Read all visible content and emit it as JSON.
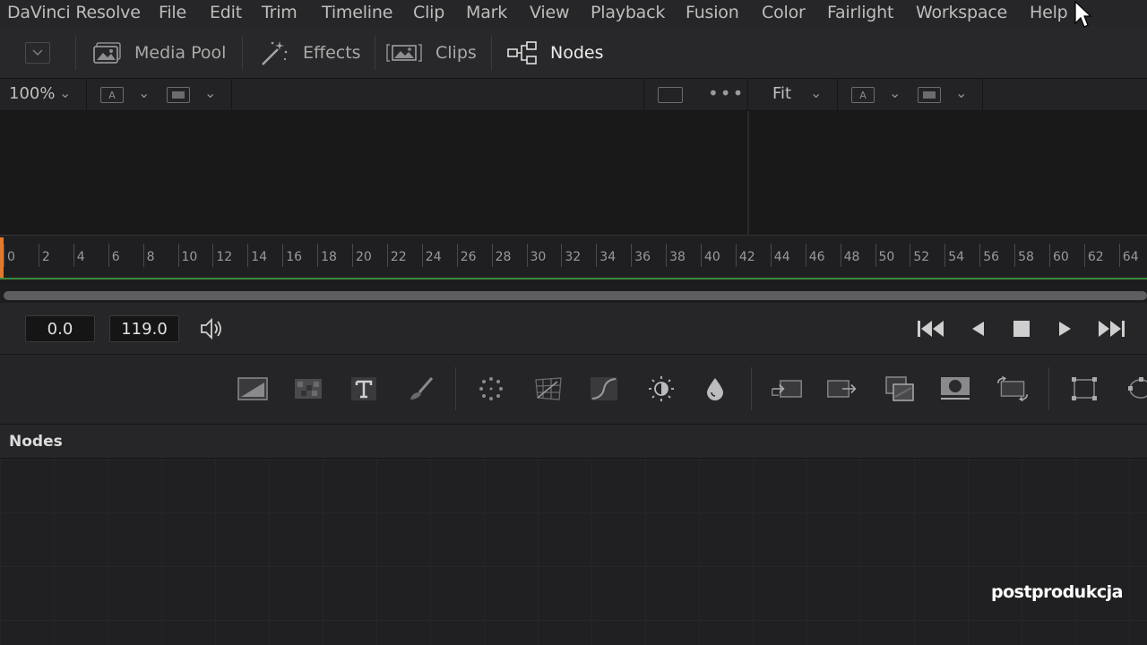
{
  "menu": [
    "DaVinci Resolve",
    "File",
    "Edit",
    "Trim",
    "Timeline",
    "Clip",
    "Mark",
    "View",
    "Playback",
    "Fusion",
    "Color",
    "Fairlight",
    "Workspace",
    "Help"
  ],
  "toolbar": {
    "media_pool": "Media Pool",
    "effects": "Effects",
    "clips": "Clips",
    "nodes": "Nodes"
  },
  "viewer": {
    "zoom": "100%",
    "fit": "Fit",
    "channel_label": "A"
  },
  "ruler_labels": [
    "0",
    "2",
    "4",
    "6",
    "8",
    "10",
    "12",
    "14",
    "16",
    "18",
    "20",
    "22",
    "24",
    "26",
    "28",
    "30",
    "32",
    "34",
    "36",
    "38",
    "40",
    "42",
    "44",
    "46",
    "48",
    "50",
    "52",
    "54",
    "56",
    "58",
    "60",
    "62",
    "64"
  ],
  "transport": {
    "current_time": "0.0",
    "end_time": "119.0"
  },
  "nodes_panel": {
    "title": "Nodes"
  },
  "watermark": "postprodukcja",
  "colors": {
    "playhead": "#e07a2e",
    "ruler_line": "#3b8a3b"
  }
}
